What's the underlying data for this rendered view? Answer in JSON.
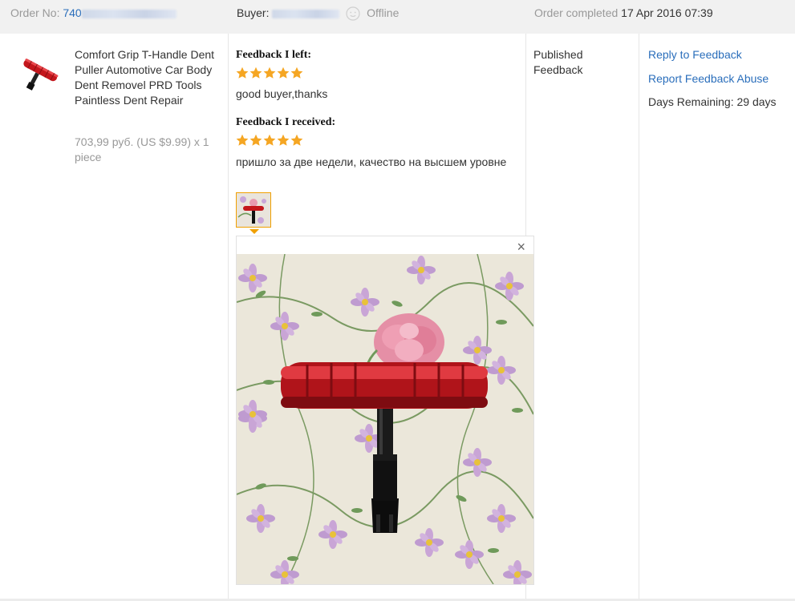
{
  "header": {
    "order_label": "Order No:",
    "order_number": "740",
    "buyer_label": "Buyer:",
    "buyer_status": "Offline",
    "completed_label": "Order completed",
    "completed_date": "17 Apr 2016 07:39"
  },
  "product": {
    "title": "Comfort Grip T-Handle Dent Puller Automotive Car Body Dent Removel PRD Tools Paintless Dent Repair",
    "price": "703,99 руб. (US $9.99) x 1 piece",
    "thumb_icon": "t-handle-dent-puller-icon"
  },
  "feedback": {
    "left_heading": "Feedback I left:",
    "left_stars": 5,
    "left_text": "good buyer,thanks",
    "received_heading": "Feedback I received:",
    "received_stars": 5,
    "received_text": "пришло за две недели, качество на высшем уровне",
    "viewer_close": "×"
  },
  "status": {
    "label": "Published Feedback"
  },
  "actions": {
    "reply": "Reply to Feedback",
    "report": "Report Feedback Abuse",
    "days_remaining": "Days Remaining: 29 days"
  },
  "colors": {
    "link": "#2a6ebb",
    "star": "#f5a623",
    "header_bg": "#f1f1f1",
    "thumb_border": "#f0a000"
  }
}
